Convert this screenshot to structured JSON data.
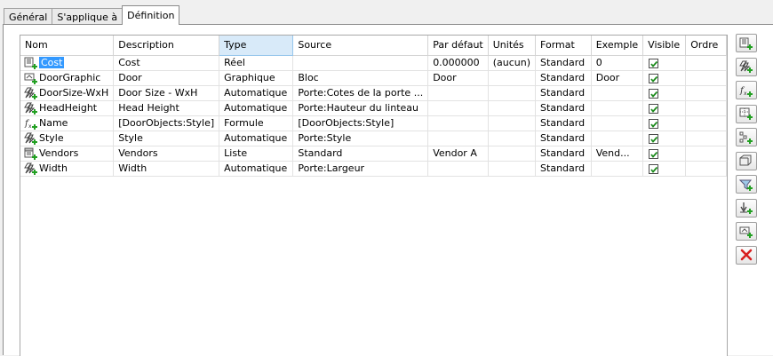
{
  "tabs": [
    {
      "label": "Général"
    },
    {
      "label": "S'applique à"
    },
    {
      "label": "Définition"
    }
  ],
  "columns": [
    "Nom",
    "Description",
    "Type",
    "Source",
    "Par défaut",
    "Unités",
    "Format",
    "Exemple",
    "Visible",
    "Ordre"
  ],
  "sorted_column": "Type",
  "rows": [
    {
      "icon": "manual-property-icon",
      "name": "Cost",
      "description": "Cost",
      "type": "Réel",
      "source": "",
      "default": "0.000000",
      "units": "(aucun)",
      "format": "Standard",
      "example": "0",
      "visible": true,
      "order": ""
    },
    {
      "icon": "graphic-property-icon",
      "name": "DoorGraphic",
      "description": "Door",
      "type": "Graphique",
      "source": "Bloc",
      "default": "Door",
      "units": "",
      "format": "Standard",
      "example": "Door",
      "visible": true,
      "order": ""
    },
    {
      "icon": "automatic-property-icon",
      "name": "DoorSize-WxH",
      "description": "Door Size - WxH",
      "type": "Automatique",
      "source": "Porte:Cotes de la porte ...",
      "default": "",
      "units": "",
      "format": "Standard",
      "example": "",
      "visible": true,
      "order": ""
    },
    {
      "icon": "automatic-property-icon",
      "name": "HeadHeight",
      "description": "Head Height",
      "type": "Automatique",
      "source": "Porte:Hauteur du linteau",
      "default": "",
      "units": "",
      "format": "Standard",
      "example": "",
      "visible": true,
      "order": ""
    },
    {
      "icon": "formula-property-icon",
      "name": "Name",
      "description": "[DoorObjects:Style]",
      "type": "Formule",
      "source": "[DoorObjects:Style]",
      "default": "",
      "units": "",
      "format": "Standard",
      "example": "",
      "visible": true,
      "order": ""
    },
    {
      "icon": "automatic-property-icon",
      "name": "Style",
      "description": "Style",
      "type": "Automatique",
      "source": "Porte:Style",
      "default": "",
      "units": "",
      "format": "Standard",
      "example": "",
      "visible": true,
      "order": ""
    },
    {
      "icon": "list-property-icon",
      "name": "Vendors",
      "description": "Vendors",
      "type": "Liste",
      "source": "Standard",
      "default": "Vendor A",
      "units": "",
      "format": "Standard",
      "example": "Vend...",
      "visible": true,
      "order": ""
    },
    {
      "icon": "automatic-property-icon",
      "name": "Width",
      "description": "Width",
      "type": "Automatique",
      "source": "Porte:Largeur",
      "default": "",
      "units": "",
      "format": "Standard",
      "example": "",
      "visible": true,
      "order": ""
    }
  ],
  "selected_cell": "Cost",
  "toolbar_buttons": [
    {
      "name": "add-manual-property-button",
      "icon": "manual-property-icon"
    },
    {
      "name": "add-automatic-property-button",
      "icon": "automatic-property-icon"
    },
    {
      "name": "add-formula-property-button",
      "icon": "formula-property-icon"
    },
    {
      "name": "add-location-property-button",
      "icon": "location-property-icon"
    },
    {
      "name": "add-classification-property-button",
      "icon": "classification-property-icon"
    },
    {
      "name": "add-material-property-button",
      "icon": "material-property-icon"
    },
    {
      "name": "add-property-set-button",
      "icon": "property-set-icon"
    },
    {
      "name": "add-anchor-property-button",
      "icon": "anchor-property-icon"
    },
    {
      "name": "add-graphic-property-button",
      "icon": "graphic-property-icon"
    },
    {
      "name": "delete-property-button",
      "icon": "delete-icon"
    }
  ],
  "colors": {
    "selection": "#3399ff",
    "sorted_header": "#d8eaf9",
    "accent_green": "#22a022",
    "delete_red": "#d82020"
  }
}
